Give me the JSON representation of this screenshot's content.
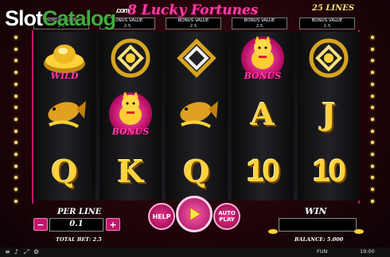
{
  "watermark": {
    "brand_slot": "Slot",
    "brand_catalog": "Catalog",
    "brand_com": ".com"
  },
  "game": {
    "title": "8 Lucky Fortunes",
    "lines": "25 LINES"
  },
  "bonus_values": [
    {
      "label": "BONUS VALUE",
      "value": "2.5"
    },
    {
      "label": "BONUS VALUE",
      "value": "2.5"
    },
    {
      "label": "BONUS VALUE",
      "value": "2.5"
    },
    {
      "label": "BONUS VALUE",
      "value": "2.5"
    },
    {
      "label": "BONUS VALUE",
      "value": "2.5"
    }
  ],
  "reels": {
    "row1": [
      {
        "symbol": "gold-ingot",
        "label": "WILD"
      },
      {
        "symbol": "gold-knot",
        "label": ""
      },
      {
        "symbol": "silver-knot",
        "label": ""
      },
      {
        "symbol": "lucky-cat",
        "label": "BONUS"
      },
      {
        "symbol": "gold-knot",
        "label": ""
      }
    ],
    "row2": [
      {
        "symbol": "gold-fish",
        "label": ""
      },
      {
        "symbol": "lucky-cat",
        "label": "BONUS"
      },
      {
        "symbol": "gold-fish",
        "label": ""
      },
      {
        "symbol": "A",
        "label": ""
      },
      {
        "symbol": "J",
        "label": ""
      }
    ],
    "row3": [
      {
        "symbol": "Q",
        "label": ""
      },
      {
        "symbol": "K",
        "label": ""
      },
      {
        "symbol": "Q",
        "label": ""
      },
      {
        "symbol": "10",
        "label": ""
      },
      {
        "symbol": "10",
        "label": ""
      }
    ]
  },
  "controls": {
    "per_line_label": "PER LINE",
    "per_line_value": "0.1",
    "minus": "−",
    "plus": "+",
    "help": "HELP",
    "auto_play": "AUTO\nPLAY",
    "win_label": "WIN",
    "win_value": "",
    "total_bet_label": "TOTAL BET: 2.5",
    "balance_label": "BALANCE: 5.000"
  },
  "status_bar": {
    "mode": "FUN",
    "time": "19:00"
  },
  "colors": {
    "accent_pink": "#ff3da6",
    "gold": "#ffd23a",
    "frame_red": "#3a0812"
  }
}
